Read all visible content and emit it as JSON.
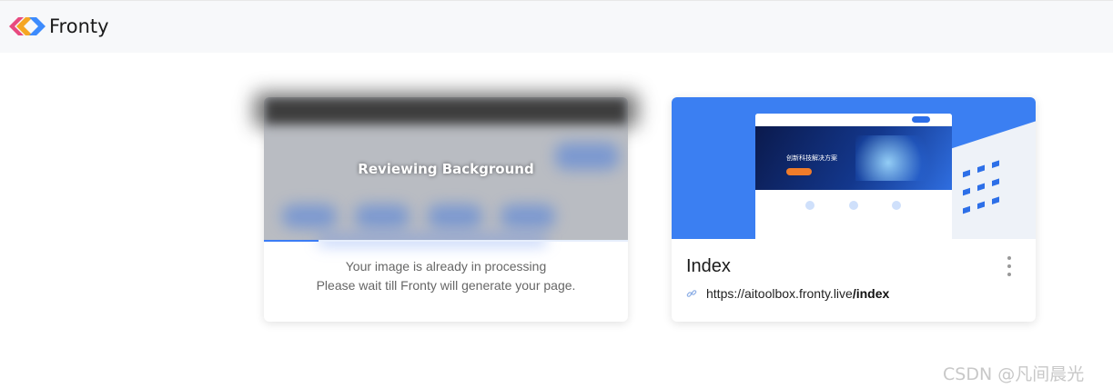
{
  "header": {
    "brand": "Fronty",
    "logo_icon": "fronty-logo-icon"
  },
  "processing_card": {
    "overlay_text": "Reviewing Background",
    "progress": 0.15,
    "message_line1": "Your image is already in processing",
    "message_line2": "Please wait till Fronty will generate your page."
  },
  "project_card": {
    "title": "Index",
    "url_prefix": "https://aitoolbox.fronty.live",
    "url_path": "/index",
    "thumbnail_hero_text": "创新科技解决方案",
    "link_icon": "link-icon",
    "menu_icon": "kebab-menu-icon"
  },
  "watermark": "CSDN @凡间晨光",
  "colors": {
    "accent": "#3b7cf5",
    "thumb_bg": "#3b7ff2"
  }
}
